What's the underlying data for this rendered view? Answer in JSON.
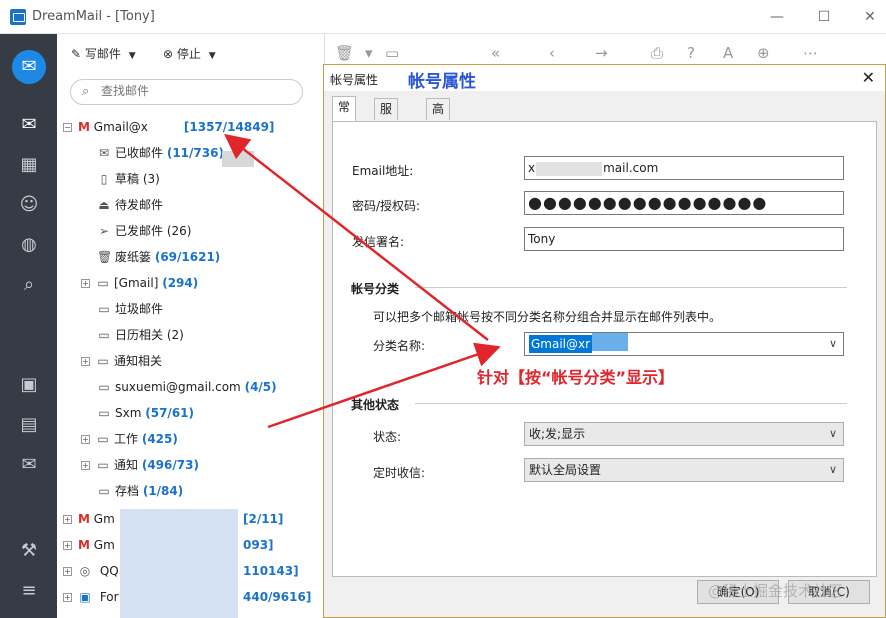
{
  "window": {
    "title": "DreamMail - [Tony]"
  },
  "toolbar": {
    "compose": "写邮件",
    "stop": "停止"
  },
  "search": {
    "placeholder": "查找邮件"
  },
  "tree": {
    "account": {
      "name": "Gmail@x",
      "count": "[1357/14849]"
    },
    "folders": [
      {
        "label": "已收邮件",
        "count": "(11/736)",
        "icon": "envelope-open-icon",
        "bold": true
      },
      {
        "label": "草稿 (3)",
        "count": "",
        "icon": "document-icon",
        "bold": false
      },
      {
        "label": "待发邮件",
        "count": "",
        "icon": "outbox-icon",
        "bold": false
      },
      {
        "label": "已发邮件 (26)",
        "count": "",
        "icon": "send-icon",
        "bold": false
      },
      {
        "label": "废纸篓",
        "count": "(69/1621)",
        "icon": "trash-icon",
        "bold": true
      },
      {
        "label": "[Gmail]",
        "count": "(294)",
        "icon": "folder-icon",
        "bold": true,
        "expander": true
      },
      {
        "label": "垃圾邮件",
        "count": "",
        "icon": "folder-icon",
        "bold": false
      },
      {
        "label": "日历相关 (2)",
        "count": "",
        "icon": "folder-icon",
        "bold": false
      },
      {
        "label": "通知相关",
        "count": "",
        "icon": "folder-icon",
        "bold": false,
        "expander": true
      },
      {
        "label": "suxuemi@gmail.com",
        "count": "(4/5)",
        "icon": "folder-icon",
        "bold": true
      },
      {
        "label": "Sxm",
        "count": "(57/61)",
        "icon": "folder-icon",
        "bold": true
      },
      {
        "label": "工作",
        "count": "(425)",
        "icon": "folder-icon",
        "bold": true,
        "expander": true
      },
      {
        "label": "通知",
        "count": "(496/73)",
        "icon": "folder-icon",
        "bold": true,
        "expander": true
      },
      {
        "label": "存档",
        "count": "(1/84)",
        "icon": "folder-icon",
        "bold": true
      }
    ],
    "other_accounts": [
      {
        "label": "Gm",
        "count": "[2/11]",
        "icon": "gmail-icon"
      },
      {
        "label": "Gm",
        "count": "093]",
        "icon": "gmail-icon"
      },
      {
        "label": "QQ",
        "count": "110143]",
        "icon": "qq-icon"
      },
      {
        "label": "For",
        "count": "440/9616]",
        "icon": "contact-icon"
      }
    ]
  },
  "dialog": {
    "title": "帐号属性",
    "annotation_title": "帐号属性",
    "tabs": [
      "常规",
      "服务器",
      "高级"
    ],
    "email_label": "Email地址:",
    "email_prefix": "x",
    "email_suffix": "mail.com",
    "password_label": "密码/授权码:",
    "password_value": "●●●●●●●●●●●●●●●●",
    "signature_label": "发信署名:",
    "signature_value": "Tony",
    "group_section": "帐号分类",
    "group_hint": "可以把多个邮箱帐号按不同分类名称分组合并显示在邮件列表中。",
    "group_name_label": "分类名称:",
    "group_name_value": "Gmail@xr",
    "other_section": "其他状态",
    "status_label": "状态:",
    "status_value": "收;发;显示",
    "schedule_label": "定时收信:",
    "schedule_value": "默认全局设置",
    "ok_button": "确定(O)",
    "cancel_button": "取消(C)"
  },
  "annotation": {
    "text": "针对【按“帐号分类”显示】",
    "color": "#e0262b"
  },
  "watermark": "@稀土掘金技术社区",
  "colors": {
    "sidebar": "#353c46",
    "accent": "#1a73c9",
    "annotation_blue": "#2b57d6"
  }
}
